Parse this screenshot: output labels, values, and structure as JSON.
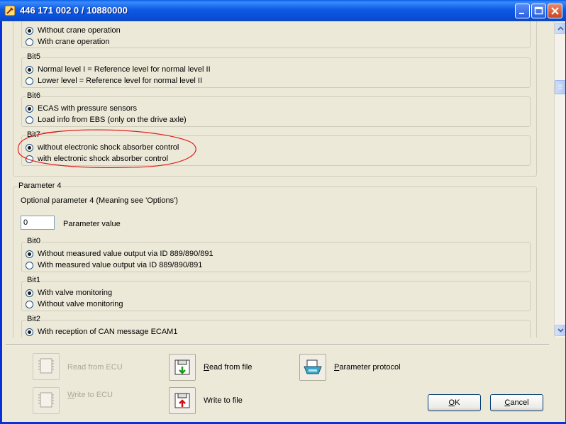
{
  "window": {
    "title": "446 171 002 0 / 10880000"
  },
  "groups_top": [
    {
      "legend": "",
      "options": [
        {
          "label": "Without crane operation",
          "checked": true
        },
        {
          "label": "With crane operation",
          "checked": false
        }
      ]
    },
    {
      "legend": "Bit5",
      "options": [
        {
          "label": "Normal level I = Reference level for normal level II",
          "checked": true
        },
        {
          "label": "Lower level = Reference level for normal level II",
          "checked": false
        }
      ]
    },
    {
      "legend": "Bit6",
      "options": [
        {
          "label": "ECAS with pressure sensors",
          "checked": true
        },
        {
          "label": "Load info from EBS (only on the drive axle)",
          "checked": false
        }
      ]
    },
    {
      "legend": "Bit7",
      "options": [
        {
          "label": "without electronic shock absorber control",
          "checked": true
        },
        {
          "label": "with electronic shock absorber control",
          "checked": false
        }
      ]
    }
  ],
  "parameter4": {
    "legend": "Parameter 4",
    "description": "Optional parameter 4 (Meaning see 'Options')",
    "input_value": "0",
    "input_label": "Parameter value",
    "groups": [
      {
        "legend": "Bit0",
        "options": [
          {
            "label": "Without measured value output via ID 889/890/891",
            "checked": true
          },
          {
            "label": "With measured value output via ID 889/890/891",
            "checked": false
          }
        ]
      },
      {
        "legend": "Bit1",
        "options": [
          {
            "label": "With valve monitoring",
            "checked": true
          },
          {
            "label": "Without valve monitoring",
            "checked": false
          }
        ]
      },
      {
        "legend": "Bit2",
        "options": [
          {
            "label": "With reception of CAN message ECAM1",
            "checked": true
          }
        ]
      }
    ]
  },
  "toolbar": {
    "read_ecu": {
      "mnemonic": "",
      "rest": "Read from ECU",
      "enabled": false
    },
    "write_ecu": {
      "mnemonic": "W",
      "rest": "rite to ECU",
      "enabled": false
    },
    "read_file": {
      "mnemonic": "R",
      "rest": "ead from file",
      "enabled": true
    },
    "write_file": {
      "mnemonic": "",
      "rest": "Write to file",
      "enabled": true
    },
    "protocol": {
      "mnemonic": "P",
      "rest": "arameter protocol",
      "enabled": true
    },
    "ok": {
      "mnemonic": "O",
      "rest": "K"
    },
    "cancel": {
      "mnemonic": "C",
      "rest": "ancel"
    }
  },
  "icons": {
    "app": "wrench-app-icon",
    "ecu": "ecu-chip-icon",
    "file_read": "floppy-read-icon",
    "file_write": "floppy-write-icon",
    "printer": "printer-icon"
  },
  "colors": {
    "titlebar": "#0A5FE8",
    "dialog_bg": "#ECE9D8",
    "annotation": "#E02020"
  }
}
